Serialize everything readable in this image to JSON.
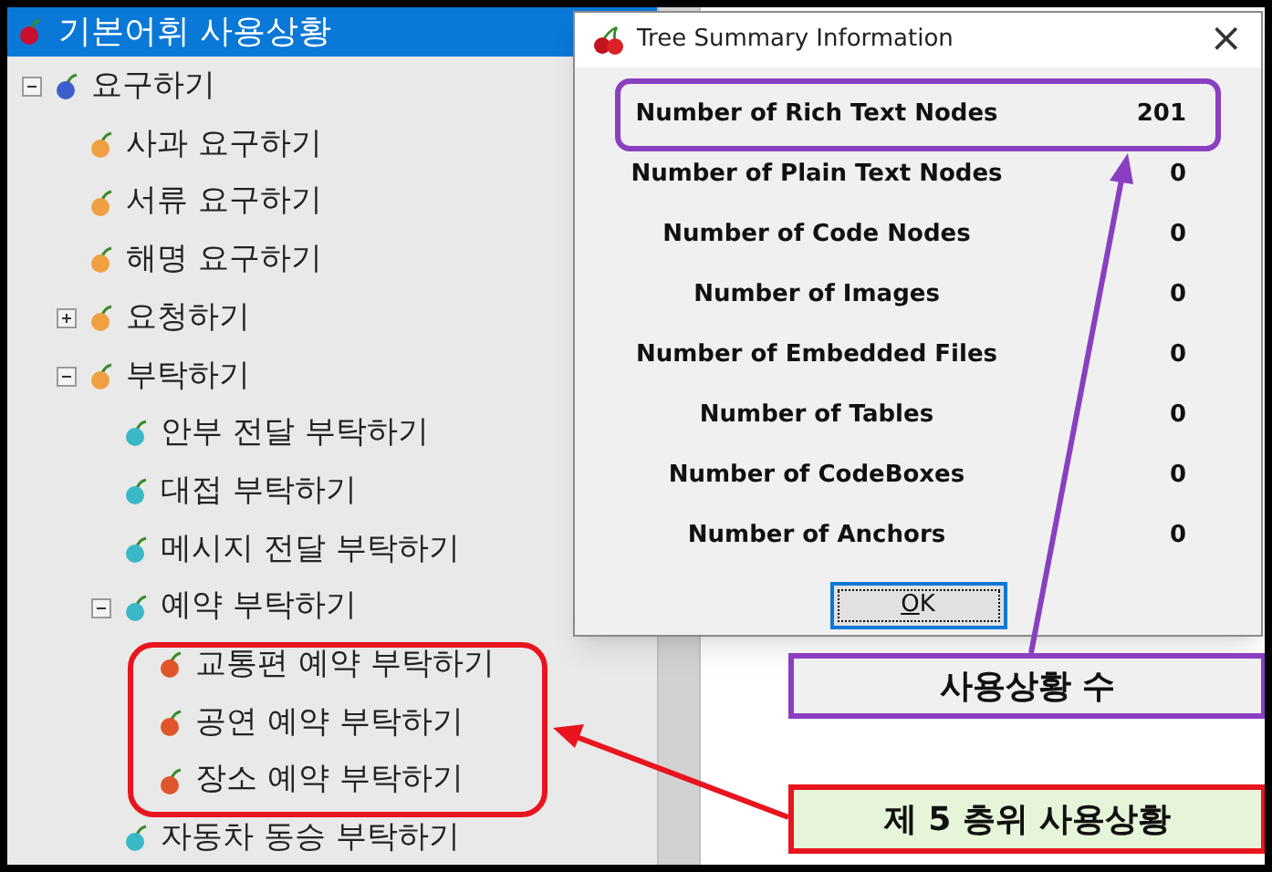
{
  "tree": {
    "label": "기본어휘 사용상황",
    "selected": true,
    "color": "#c8102e",
    "children": [
      {
        "label": "요구하기",
        "expanded": true,
        "color": "#3a5fcd",
        "children": [
          {
            "label": "사과 요구하기",
            "color": "#f0a040"
          },
          {
            "label": "서류 요구하기",
            "color": "#f0a040"
          },
          {
            "label": "해명 요구하기",
            "color": "#f0a040"
          },
          {
            "label": "요청하기",
            "expanded": false,
            "color": "#f0a040"
          },
          {
            "label": "부탁하기",
            "expanded": true,
            "color": "#f0a040",
            "children": [
              {
                "label": "안부 전달 부탁하기",
                "color": "#3ab8c8"
              },
              {
                "label": "대접 부탁하기",
                "color": "#3ab8c8"
              },
              {
                "label": "메시지 전달 부탁하기",
                "color": "#3ab8c8"
              },
              {
                "label": "예약 부탁하기",
                "expanded": true,
                "color": "#3ab8c8",
                "children": [
                  {
                    "label": "교통편 예약 부탁하기",
                    "color": "#e0562a"
                  },
                  {
                    "label": "공연 예약 부탁하기",
                    "color": "#e0562a"
                  },
                  {
                    "label": "장소 예약 부탁하기",
                    "color": "#e0562a"
                  }
                ]
              },
              {
                "label": "자동차 동승 부탁하기",
                "color": "#3ab8c8"
              }
            ]
          }
        ]
      }
    ]
  },
  "dialog": {
    "title": "Tree Summary Information",
    "close": "×",
    "rows": [
      {
        "label": "Number of Rich Text Nodes",
        "value": "201",
        "selected": true
      },
      {
        "label": "Number of Plain Text Nodes",
        "value": "0",
        "selected": false
      },
      {
        "label": "Number of Code Nodes",
        "value": "0",
        "selected": false
      },
      {
        "label": "Number of Images",
        "value": "0",
        "selected": false
      },
      {
        "label": "Number of Embedded Files",
        "value": "0",
        "selected": false
      },
      {
        "label": "Number of Tables",
        "value": "0",
        "selected": false
      },
      {
        "label": "Number of CodeBoxes",
        "value": "0",
        "selected": false
      },
      {
        "label": "Number of Anchors",
        "value": "0",
        "selected": false
      }
    ],
    "ok_button": {
      "mnemonic": "O",
      "rest": "K"
    }
  },
  "callouts": [
    {
      "text": "사용상황 수",
      "kind": "count"
    },
    {
      "text": "제 5 층위 사용상황",
      "kind": "level"
    }
  ]
}
